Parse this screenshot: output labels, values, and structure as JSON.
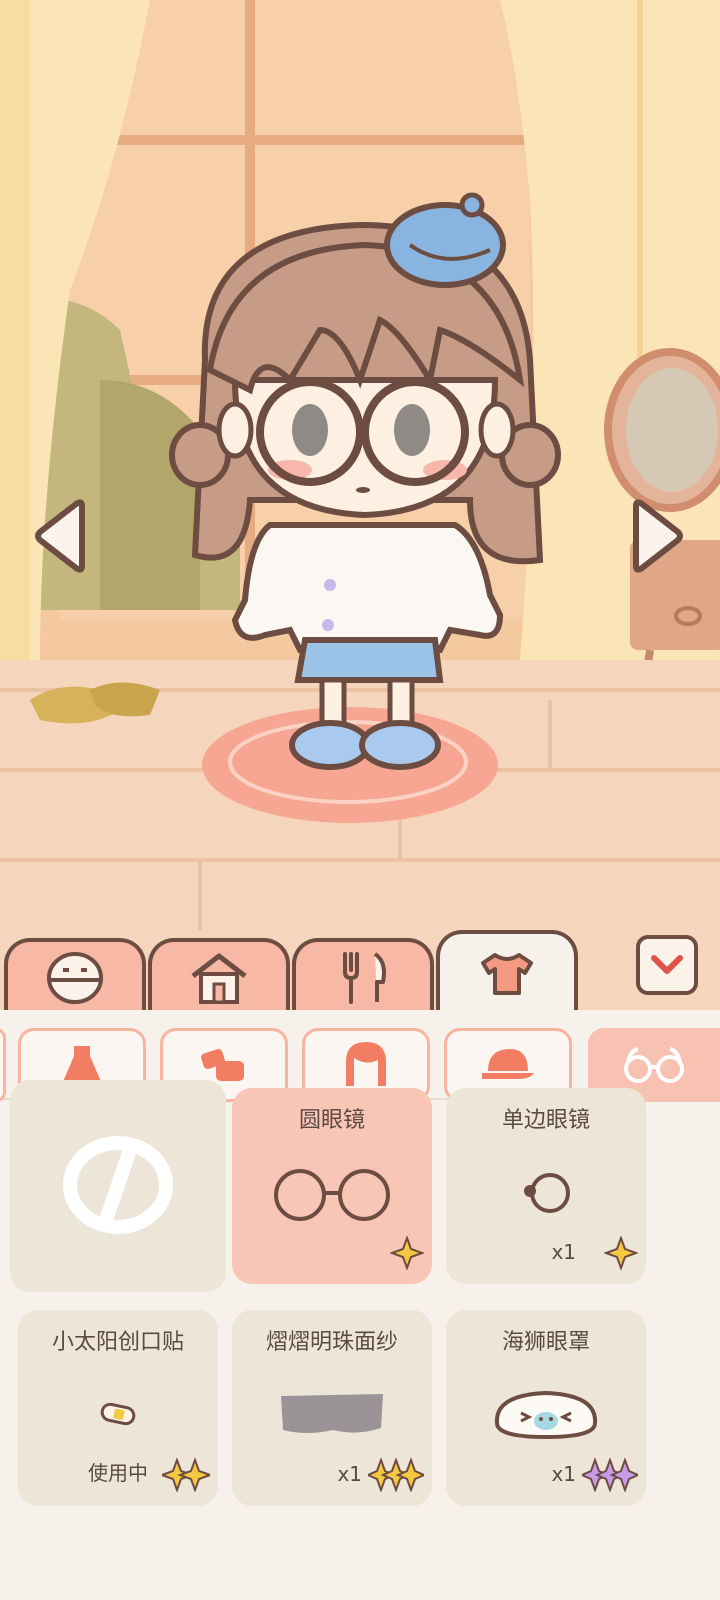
{
  "scene": {
    "name": "dress-up-room"
  },
  "tabs": [
    {
      "id": "face",
      "icon": "face-icon"
    },
    {
      "id": "home",
      "icon": "house-icon"
    },
    {
      "id": "food",
      "icon": "fork-knife-icon"
    },
    {
      "id": "clothes",
      "icon": "shirt-icon",
      "active": true
    }
  ],
  "subcategories": [
    {
      "id": "dress",
      "icon": "dress-icon"
    },
    {
      "id": "shoes",
      "icon": "shoes-icon"
    },
    {
      "id": "hair",
      "icon": "hair-icon"
    },
    {
      "id": "hat",
      "icon": "cap-icon"
    },
    {
      "id": "glasses",
      "icon": "glasses-icon",
      "active": true
    }
  ],
  "items": [
    {
      "id": "none",
      "name": "",
      "count": "",
      "icon": "none-icon",
      "stars": 0
    },
    {
      "id": "round-glasses",
      "name": "圆眼镜",
      "count": "",
      "icon": "round-glasses-icon",
      "stars": 1,
      "selected": true
    },
    {
      "id": "monocle",
      "name": "单边眼镜",
      "count": "x1",
      "icon": "monocle-icon",
      "stars": 1
    },
    {
      "id": "bandage",
      "name": "小太阳创口贴",
      "count": "使用中",
      "icon": "bandage-icon",
      "stars": 2
    },
    {
      "id": "veil",
      "name": "熠熠明珠面纱",
      "count": "x1",
      "icon": "veil-icon",
      "stars": 3
    },
    {
      "id": "eye-mask",
      "name": "海狮眼罩",
      "count": "x1",
      "icon": "seal-eye-mask-icon",
      "stars": 3
    }
  ],
  "colors": {
    "outline": "#6d4c41",
    "tab_inactive": "#f7b8a5",
    "panel_bg": "#f6f1ea",
    "selected_item": "#f8c5b7",
    "star_yellow": "#f5c842",
    "star_purple": "#c89be8"
  }
}
